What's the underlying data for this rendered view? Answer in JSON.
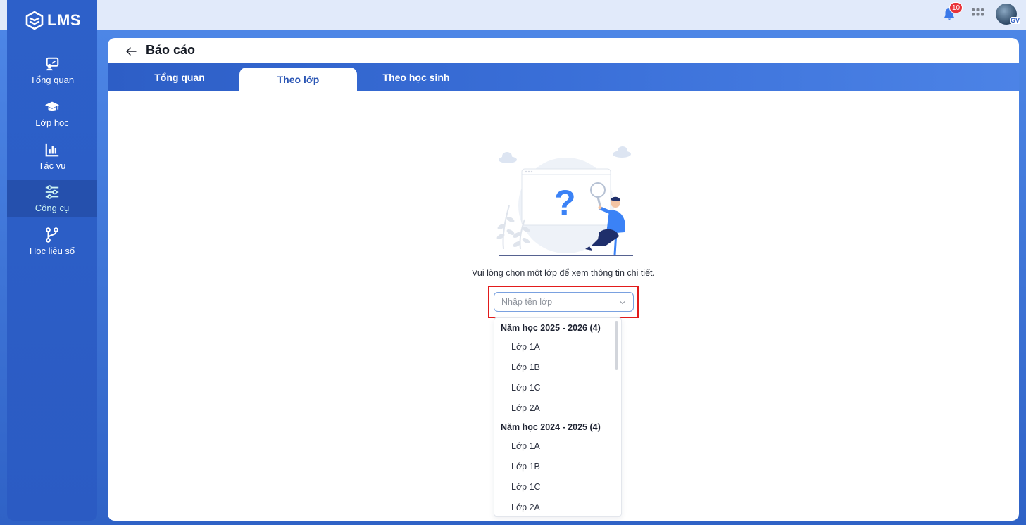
{
  "app": {
    "logo_text": "LMS"
  },
  "sidebar": {
    "items": [
      {
        "label": "Tổng quan",
        "icon": "chalkboard-icon"
      },
      {
        "label": "Lớp học",
        "icon": "graduation-cap-icon"
      },
      {
        "label": "Tác vụ",
        "icon": "bar-chart-icon"
      },
      {
        "label": "Công cụ",
        "icon": "sliders-icon",
        "active": true
      },
      {
        "label": "Học liệu số",
        "icon": "git-branch-icon"
      }
    ]
  },
  "topbar": {
    "notification_count": "10",
    "avatar_label": "GV"
  },
  "page": {
    "title": "Báo cáo",
    "tabs": [
      {
        "label": "Tổng quan"
      },
      {
        "label": "Theo lớp",
        "active": true
      },
      {
        "label": "Theo học sinh"
      }
    ],
    "prompt": "Vui lòng chọn một lớp để xem thông tin chi tiết.",
    "select": {
      "placeholder": "Nhập tên lớp",
      "value": ""
    },
    "dropdown": {
      "groups": [
        {
          "label": "Năm học 2025 - 2026 (4)",
          "options": [
            "Lớp 1A",
            "Lớp 1B",
            "Lớp 1C",
            "Lớp 2A"
          ]
        },
        {
          "label": "Năm học 2024 - 2025 (4)",
          "options": [
            "Lớp 1A",
            "Lớp 1B",
            "Lớp 1C",
            "Lớp 2A"
          ]
        }
      ]
    }
  },
  "colors": {
    "primary": "#2d60c9",
    "accent_active": "#cff6f4",
    "highlight": "#e21b1b",
    "badge": "#e8333a"
  }
}
